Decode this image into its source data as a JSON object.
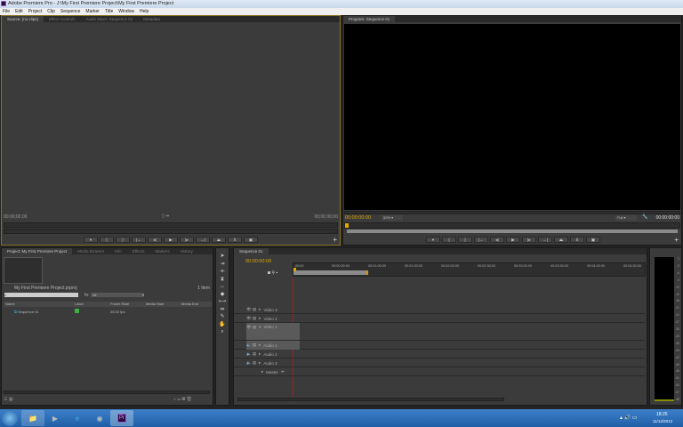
{
  "window": {
    "title": "Adobe Premiere Pro - J:\\My First Premiere Project\\My First Premiere Project"
  },
  "menu": [
    "File",
    "Edit",
    "Project",
    "Clip",
    "Sequence",
    "Marker",
    "Title",
    "Window",
    "Help"
  ],
  "source_panel": {
    "tabs": [
      "Source: (no clips)",
      "Effect Controls",
      "Audio Mixer: Sequence 01",
      "Metadata"
    ],
    "tc_left": "00;00;00;00",
    "tc_right": "00;00;00;00"
  },
  "program_panel": {
    "tab": "Program: Sequence 01",
    "tc_left": "00:00:00:00",
    "zoom": "50%",
    "quality": "Full",
    "tc_right": "00:00:00:00"
  },
  "transport_icons": [
    "marker",
    "in",
    "out",
    "go-to-in",
    "step-back",
    "play",
    "step-forward",
    "go-to-out",
    "lift",
    "extract",
    "export-frame"
  ],
  "project_panel": {
    "tabs": [
      "Project: My First Premiere Project",
      "Media Browser",
      "Info",
      "Effects",
      "Markers",
      "History"
    ],
    "project_file": "My First Premiere Project.prproj",
    "item_count": "1 Item",
    "in_label": "In:",
    "in_value": "All",
    "columns": [
      "Name",
      "Label",
      "Frame Rate",
      "Media Start",
      "Media End"
    ],
    "rows": [
      {
        "name": "Sequence 01",
        "label_color": "#3cb043",
        "frame_rate": "25.00 fps",
        "media_start": "",
        "media_end": ""
      }
    ]
  },
  "timeline": {
    "tab": "Sequence 01",
    "timecode": "00:00:00:00",
    "ruler": [
      "00:00",
      "00:00:30:00",
      "00:01:00:00",
      "00:01:30:00",
      "00:02:00:00",
      "00:02:30:00",
      "00:03:00:00",
      "00:03:30:00",
      "00:04:00:00",
      "00:04:30:00"
    ],
    "tracks": [
      "Video 3",
      "Video 2",
      "Video 1",
      "Audio 1",
      "Audio 2",
      "Audio 3",
      "Master"
    ]
  },
  "meter": {
    "labels": [
      "0",
      "-3",
      "-6",
      "-9",
      "-12",
      "-15",
      "-18",
      "-21",
      "-24",
      "-27",
      "-30",
      "-33",
      "-36",
      "-39",
      "-42",
      "-45",
      "-48",
      "-51",
      "-54",
      "-57",
      "dB"
    ]
  },
  "taskbar": {
    "time": "18:25",
    "date": "11/12/2012",
    "apps": [
      "Explorer",
      "Media Player",
      "Internet Explorer",
      "Chrome",
      "Pr"
    ]
  }
}
